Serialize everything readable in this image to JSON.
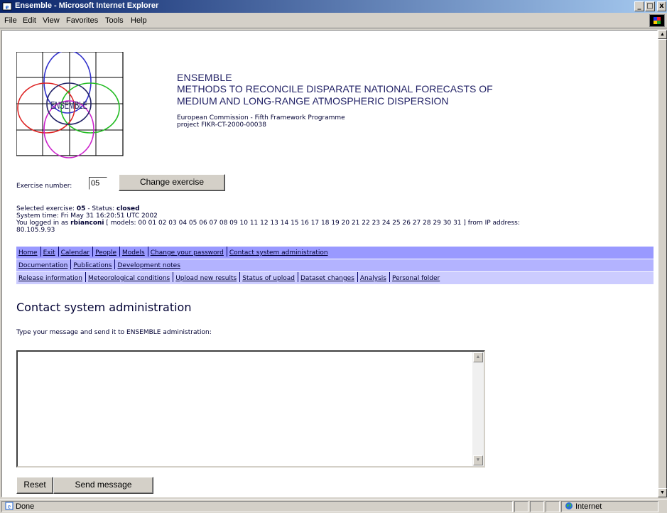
{
  "window": {
    "title": "Ensemble - Microsoft Internet Explorer",
    "buttons": {
      "minimize": "_",
      "maximize": "□",
      "close": "x"
    }
  },
  "menu": {
    "items": [
      "File",
      "Edit",
      "View",
      "Favorites",
      "Tools",
      "Help"
    ]
  },
  "header": {
    "logo_text": "ENSEMBLE",
    "site_name": "ENSEMBLE",
    "project_title_line1": "METHODS TO RECONCILE DISPARATE NATIONAL FORECASTS OF",
    "project_title_line2": "MEDIUM AND LONG-RANGE ATMOSPHERIC DISPERSION",
    "funding": "European Commission - Fifth Framework Programme",
    "project_code": "project FIKR-CT-2000-00038"
  },
  "exercise": {
    "label": "Exercise number:",
    "value": "05",
    "change_button": "Change exercise"
  },
  "info": {
    "selected_prefix": "Selected exercise: ",
    "selected_value": "05",
    "status_prefix": " - Status: ",
    "status_value": "closed",
    "system_time": "System time: Fri May 31 16:20:51 UTC 2002",
    "login_prefix": "You logged in as ",
    "user": "rbianconi",
    "login_suffix": " [ models: 00 01 02 03 04 05 06 07 08 09 10 11 12 13 14 15 16 17 18 19 20 21 22 23 24 25 26 27 28 29 30 31 ] from IP address:",
    "ip": "80.105.9.93"
  },
  "nav": {
    "row1": [
      "Home",
      "Exit",
      "Calendar",
      "People",
      "Models",
      "Change your password",
      "Contact system administration"
    ],
    "row2": [
      "Documentation",
      "Publications",
      "Development notes"
    ],
    "row3": [
      "Release information",
      "Meteorological conditions",
      "Upload new results",
      "Status of upload",
      "Dataset changes",
      "Analysis",
      "Personal folder"
    ],
    "colors": {
      "row1": "#9999ff",
      "row2": "#b3b3ff",
      "row3": "#ccccff"
    }
  },
  "content": {
    "section_title": "Contact system administration",
    "instruction": "Type your message and send it to ENSEMBLE administration:",
    "message_value": "",
    "reset_button": "Reset",
    "send_button": "Send message"
  },
  "statusbar": {
    "status": "Done",
    "zone": "Internet"
  }
}
